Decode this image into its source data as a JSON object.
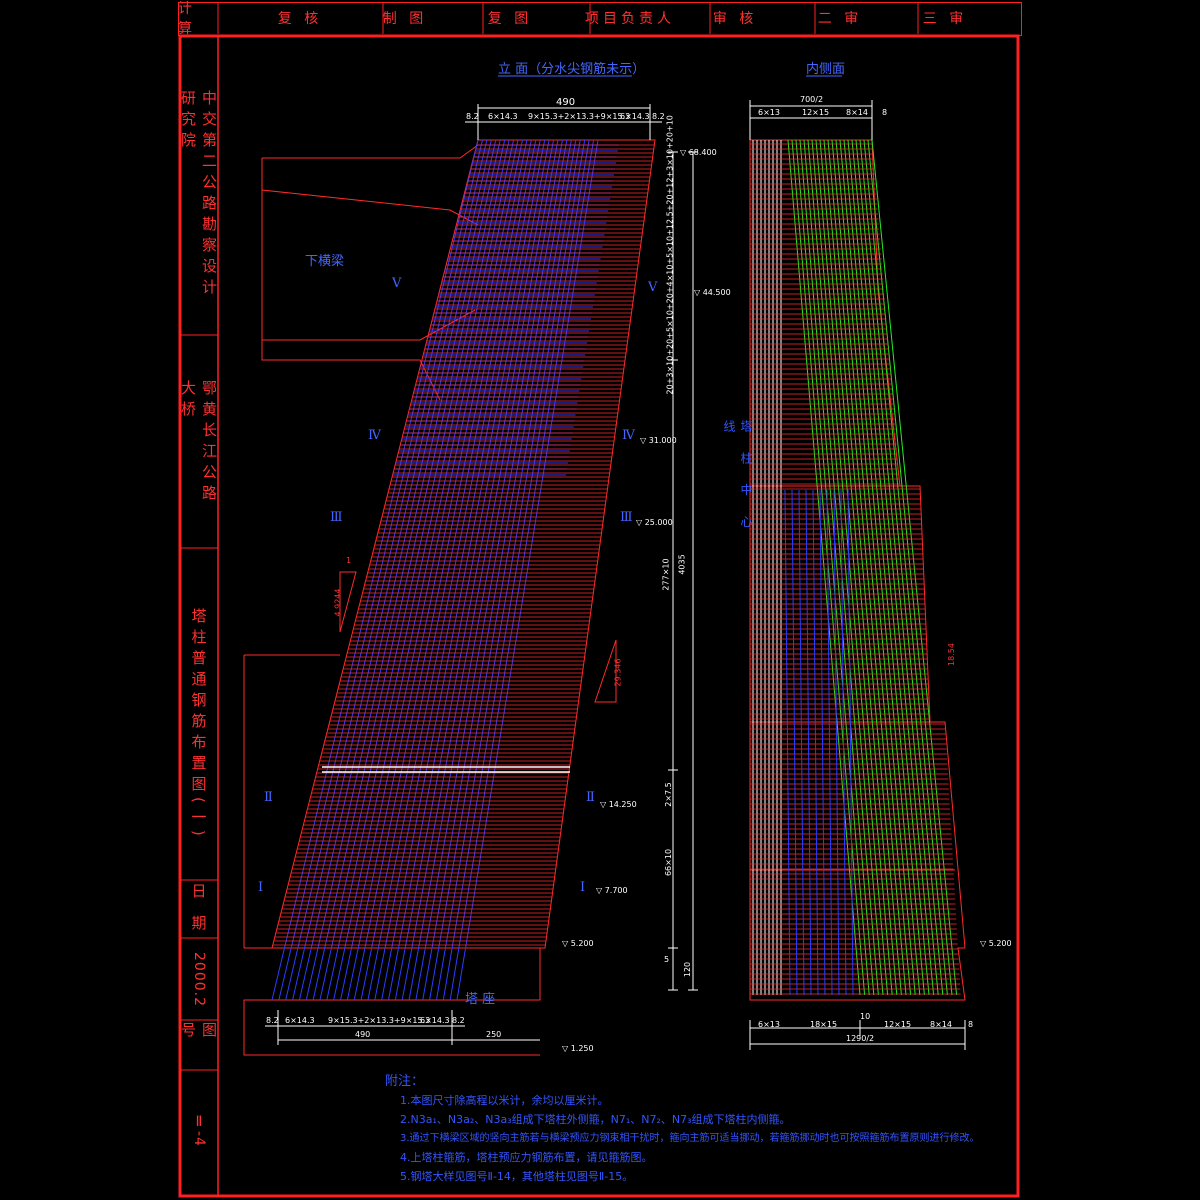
{
  "header": {
    "cells": [
      "计 算",
      "复 核",
      "制 图",
      "复 图",
      "项目负责人",
      "审 核",
      "二 审",
      "三 审"
    ]
  },
  "sidebar": {
    "institute": "中交第二公路勘察设计研究院",
    "project": "鄂黄长江公路大桥",
    "drawing_title": "塔柱普通钢筋布置图(一)",
    "date_label": "日 期",
    "date_value": "2000.2",
    "sheet_label": "图 号",
    "sheet_value": "Ⅱ-4"
  },
  "views": {
    "elevation_title": "立 面（分水尖钢筋未示）",
    "side_title": "内侧面",
    "lower_beam": "下横梁",
    "pier_top": "塔 座",
    "center_line": "塔 柱 中 心 线",
    "romans": [
      "Ⅴ",
      "Ⅴ",
      "Ⅳ",
      "Ⅳ",
      "Ⅲ",
      "Ⅲ",
      "Ⅱ",
      "Ⅱ",
      "Ⅰ",
      "Ⅰ"
    ]
  },
  "dims": {
    "top_total": "490",
    "top_left": "8.2",
    "top_a": "6×14.3",
    "top_mid": "9×15.3+2×13.3+9×15.3",
    "top_b": "6×14.3",
    "top_right": "8.2",
    "bot_total": "490",
    "bot_left": "8.2",
    "bot_a": "6×14.3",
    "bot_mid": "9×15.3+2×13.3+9×15.3",
    "bot_b": "6×14.3",
    "bot_right": "8.2",
    "bot_extra": "250",
    "side_top_total": "700/2",
    "side_top_a": "6×13",
    "side_top_b": "12×15",
    "side_top_c": "8×14",
    "side_top_d": "8",
    "side_bot_total": "1290/2",
    "side_bot_a": "6×13",
    "side_bot_b": "18×15",
    "side_bot_c": "10",
    "side_bot_d": "12×15",
    "side_bot_e": "8×14",
    "side_bot_f": "8",
    "vert_total": "4035",
    "vert_a": "277×10",
    "vert_b": "2×7.5",
    "vert_c": "66×10",
    "vert_d": "5",
    "vert_e": "120",
    "vert_top": "20+3×10+20+5×10+20+4×10+5×10+12.5+20+12+3×10+20+10",
    "slope_1": "1",
    "slope_2": "4.9244",
    "slope_3": "29.346",
    "slope_4": "18.54",
    "elev_1": "▽ 68.400",
    "elev_2": "▽ 44.500",
    "elev_3": "▽ 25.000",
    "elev_4": "▽ 14.250",
    "elev_5": "▽ 7.700",
    "elev_6": "▽ 5.200",
    "elev_7": "▽ 1.250",
    "elev_8": "▽ 5.200",
    "elev_9": "▽ 31.000"
  },
  "notes": {
    "heading": "附注：",
    "items": [
      "1.本图尺寸除高程以米计，余均以厘米计。",
      "2.N3a₁、N3a₂、N3a₃组成下塔柱外侧箍，N7₁、N7₂、N7₃组成下塔柱内侧箍。",
      "3.通过下横梁区域的竖向主筋若与横梁预应力钢束相干扰时，箍向主筋可适当挪动，若箍筋挪动时也可按照箍筋布置原则进行修改。",
      "4.上塔柱箍筋，塔柱预应力钢筋布置，请见箍筋图。",
      "5.钢塔大样见图号Ⅱ-14，其他塔柱见图号Ⅱ-15。"
    ]
  },
  "colors": {
    "frame": "#ff2020",
    "blue_rebar": "#2c3cff",
    "red_rebar": "#ff2a2a",
    "green_rebar": "#22ee22",
    "white_rebar": "#ffffff"
  }
}
